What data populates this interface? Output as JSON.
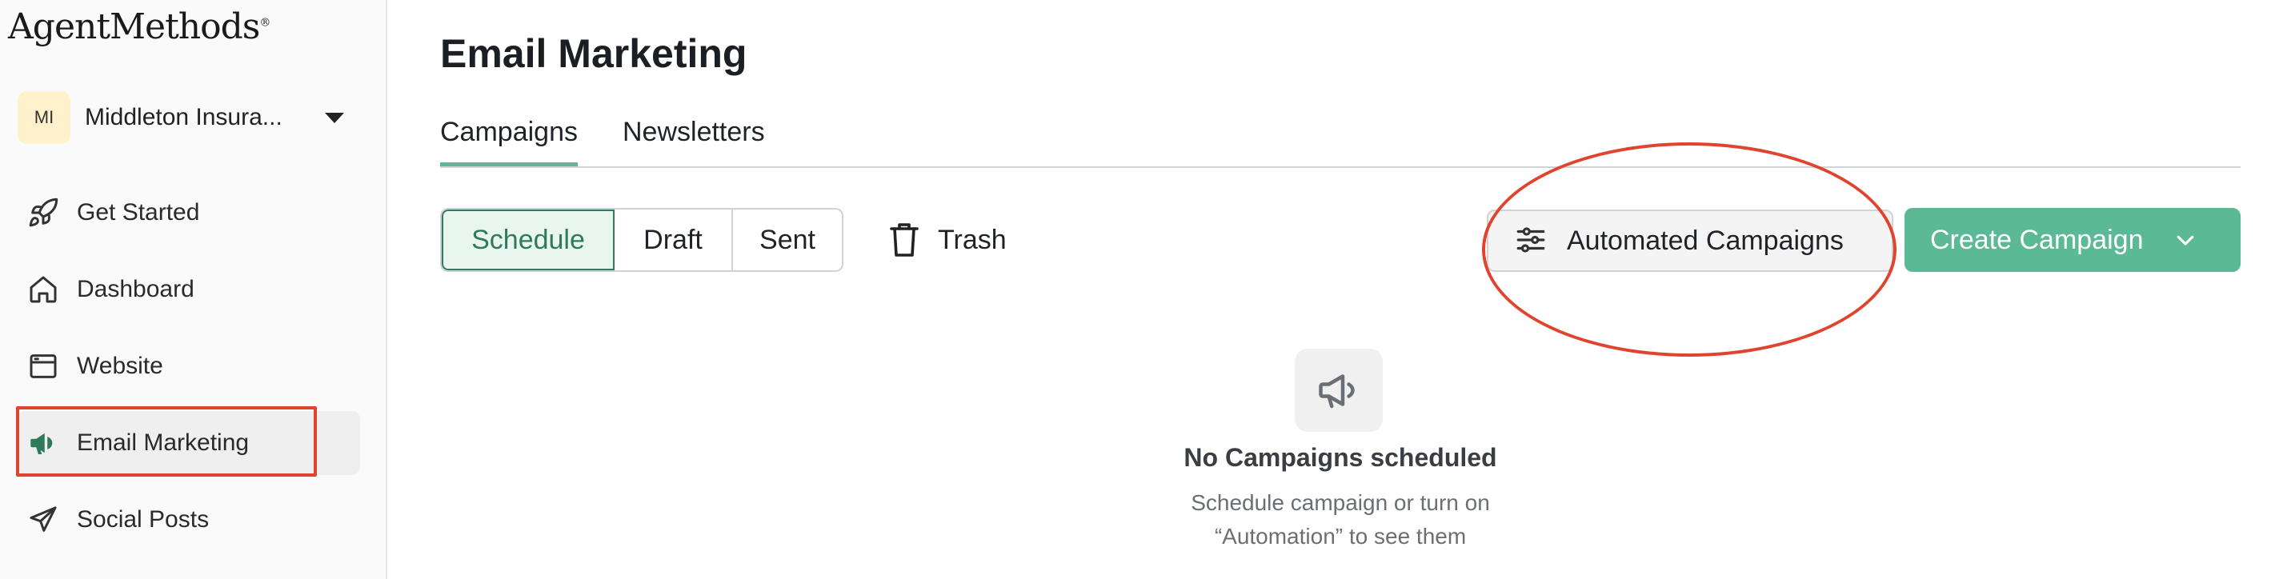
{
  "app": {
    "brand": "AgentMethods",
    "brand_mark": "®"
  },
  "sidebar": {
    "org": {
      "initials": "MI",
      "name": "Middleton Insura..."
    },
    "items": [
      {
        "label": "Get Started",
        "icon": "rocket-icon"
      },
      {
        "label": "Dashboard",
        "icon": "home-icon"
      },
      {
        "label": "Website",
        "icon": "browser-icon"
      },
      {
        "label": "Email Marketing",
        "icon": "megaphone-icon",
        "active": true
      },
      {
        "label": "Social Posts",
        "icon": "send-icon"
      }
    ]
  },
  "main": {
    "title": "Email Marketing",
    "tabs": [
      {
        "label": "Campaigns",
        "active": true
      },
      {
        "label": "Newsletters"
      }
    ],
    "filters": [
      {
        "label": "Schedule",
        "active": true
      },
      {
        "label": "Draft"
      },
      {
        "label": "Sent"
      }
    ],
    "trash_label": "Trash",
    "automated_label": "Automated Campaigns",
    "create_label": "Create Campaign",
    "empty": {
      "title": "No Campaigns scheduled",
      "subtitle_line1": "Schedule campaign or turn on",
      "subtitle_line2": "“Automation” to see them"
    }
  },
  "colors": {
    "accent": "#5bb995",
    "accent_dark": "#2f7a5a",
    "annotation": "#e0442f"
  }
}
